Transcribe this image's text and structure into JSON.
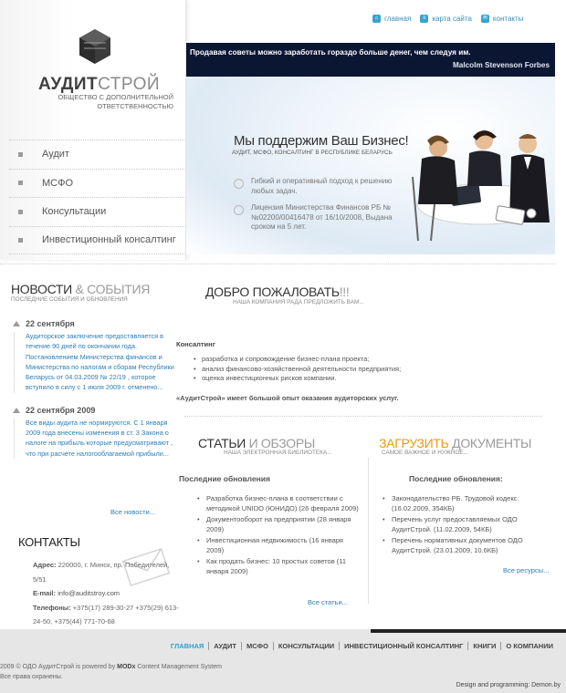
{
  "top_links": [
    {
      "label": "главная",
      "icon": "home-icon",
      "glyph": "⌂"
    },
    {
      "label": "карта сайта",
      "icon": "sitemap-icon",
      "glyph": "≡"
    },
    {
      "label": "контакты",
      "icon": "contacts-icon",
      "glyph": "✉"
    }
  ],
  "logo": {
    "name_bold": "АУДИТ",
    "name_light": "СТРОЙ",
    "subtitle": "ОБЩЕСТВО С ДОПОЛНИТЕЛЬНОЙ ОТВЕТСТВЕННОСТЬЮ"
  },
  "nav": [
    {
      "label": "Аудит"
    },
    {
      "label": "МСФО"
    },
    {
      "label": "Консультации"
    },
    {
      "label": "Инвестиционный консалтинг"
    }
  ],
  "quote": {
    "text": "Продавая советы можно заработать гораздо больше денег, чем следуя им.",
    "author": "Malcolm Stevenson Forbes"
  },
  "hero": {
    "title": "Мы поддержим Ваш Бизнес!",
    "subtitle": "АУДИТ, МСФО, КОНСАЛТИНГ В РЕСПУБЛИКЕ БЕЛАРУСЬ",
    "points": [
      "Гибкий и оперативный подход к решению любых задач.",
      "Лицензия Министерства Финансов РБ №№02200/00416478 от 16/10/2008, Выдана сроком на 5 лет."
    ]
  },
  "news": {
    "title_main": "НОВОСТИ",
    "title_accent": " & СОБЫТИЯ",
    "subtitle": "ПОСЛЕДНИЕ СОБЫТИЯ И ОБНОВЛЕНИЯ",
    "items": [
      {
        "date": "22 сентября",
        "text": "Аудиторское заключение предоставляется в течение 90 дней по окончании года. Постановлением Министерства финансов и Министерства по налогам и сборам Республики Беларусь от 04.03.2009 № 22/19 , которое вступило в силу с 1 июля 2009 г. отменено..."
      },
      {
        "date": "22 сентября 2009",
        "text": "Все виды аудита не нормируются. С 1 января 2009 года внесены изменения в ст. 3 Закона о налоге на прибыль которые предусматривают , что при расчете налогооблагаемой прибыли..."
      }
    ],
    "more": "Все новости..."
  },
  "contacts": {
    "title": "КОНТАКТЫ",
    "address_label": "Адрес:",
    "address": "220000, г. Минск, пр. Победителей, 5/51",
    "email_label": "E-mail:",
    "email": "info@auditstroy.com",
    "phones_label": "Телефоны:",
    "phones": "+375(17) 289-30-27 +375(29) 613-24-50, +375(44) 771-70-68"
  },
  "welcome": {
    "title_main": "ДОБРО ПОЖАЛОВАТЬ",
    "title_accent": "!!!",
    "subtitle": "НАША КОМПАНИЯ РАДА ПРЕДЛОЖИТЬ ВАМ...",
    "section_title": "Консалтинг",
    "items": [
      "разработка и сопровождение бизнес-плана проекта;",
      "анализ финансово-хозяйственной деятельности предприятия;",
      "оценка инвестиционных рисков компании."
    ],
    "note": "«АудитСтрой» имеет большой опыт оказания аудиторских услуг."
  },
  "articles": {
    "title_main": "СТАТЬИ",
    "title_accent": " И ОБЗОРЫ",
    "subtitle": "НАША ЭЛЕКТРОННАЯ БИБЛИОТЕКА...",
    "section_title": "Последние обновления",
    "items": [
      "Разработка бизнес-плана в соответствии с методикой UNIDO (ЮНИДО) (26 февраля 2009)",
      "Документооборот на предприятии (28 января 2009)",
      "Инвестиционная недвижимость (16 января 2009)",
      "Как продать бизнес: 10 простых советов (11 января 2009)"
    ],
    "more": "Все статьи..."
  },
  "downloads": {
    "title_main": "ЗАГРУЗИТЬ",
    "title_accent": " ДОКУМЕНТЫ",
    "subtitle": "САМОЕ ВАЖНОЕ И НУЖНОЕ...",
    "section_title": "Последние обновления:",
    "items": [
      "Законодательство РБ. Трудовой кодекс. (16.02.2009, 354КБ)",
      "Перечень услуг предоставляемых ОДО АудитСтрой. (11.02.2009, 54КБ)",
      "Перечень нормативных документов ОДО АудитСтрой. (23.01.2009, 10.6КБ)"
    ],
    "more": "Все ресурсы..."
  },
  "footer": {
    "nav": [
      "ГЛАВНАЯ",
      "АУДИТ",
      "МСФО",
      "КОНСУЛЬТАЦИИ",
      "ИНВЕСТИЦИОННЫЙ КОНСАЛТИНГ",
      "КНИГИ",
      "О КОМПАНИИ"
    ],
    "copy_line1_pre": "2009 © ОДО АудитСтрой is powered by ",
    "copy_brand": "MODx",
    "copy_line1_post": " Content Management System",
    "copy_line2": "Все права охранены.",
    "design": "Design and programming: Demon.by"
  },
  "colors": {
    "link": "#2a7fb8",
    "quote_bg": "#0b1633",
    "accent_orange": "#e89a1a",
    "footer_active": "#2a9fd6"
  }
}
